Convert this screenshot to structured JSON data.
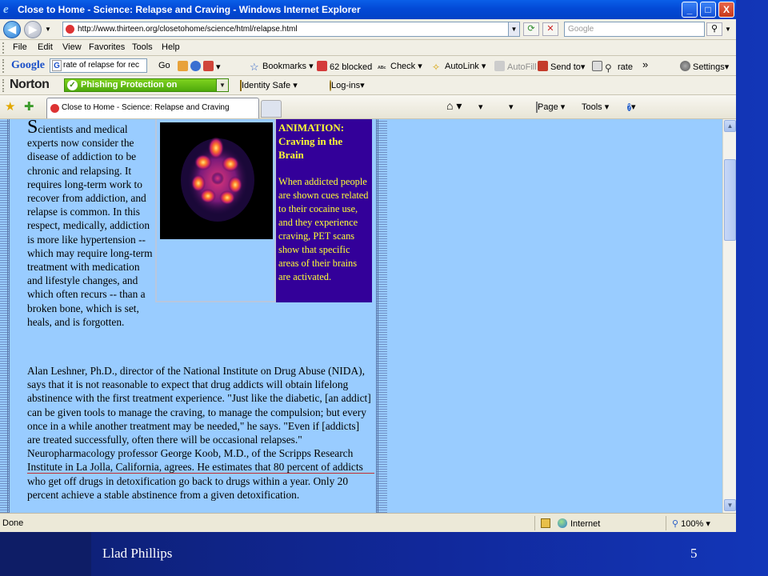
{
  "window": {
    "title": "Close to Home - Science: Relapse and Craving - Windows Internet Explorer",
    "controls": {
      "minimize": "_",
      "maximize": "□",
      "close": "X"
    }
  },
  "address_bar": {
    "url": "http://www.thirteen.org/closetohome/science/html/relapse.html",
    "search_placeholder": "Google"
  },
  "menu": [
    "File",
    "Edit",
    "View",
    "Favorites",
    "Tools",
    "Help"
  ],
  "google_toolbar": {
    "logo": "Google",
    "search_value": "rate of relapse for rec",
    "go_label": "Go",
    "bookmarks": "Bookmarks",
    "blocked": "62 blocked",
    "check": "Check",
    "autolink": "AutoLink",
    "autofill": "AutoFill",
    "send_to": "Send to",
    "rate": "rate",
    "more": "»",
    "settings": "Settings"
  },
  "norton_toolbar": {
    "logo": "Norton",
    "phishing": "Phishing Protection on",
    "identity": "Identity Safe",
    "logins": "Log-ins"
  },
  "tab": {
    "label": "Close to Home - Science: Relapse and Craving"
  },
  "command_bar": {
    "page": "Page",
    "tools": "Tools",
    "help": "?"
  },
  "article": {
    "drop_cap": "S",
    "intro": "cientists and medical experts now consider the disease of addiction to be chronic and relapsing. It requires long-term work to recover from addiction, and relapse is common. In this respect, medically, addiction is more like hypertension -- which may require long-term treatment with medication and lifestyle changes, and which often recurs -- than a broken bone, which is set, heals, and is forgotten.",
    "paragraph": "Alan Leshner, Ph.D., director of the National Institute on Drug Abuse (NIDA), says that it is not reasonable to expect that drug addicts will obtain lifelong abstinence with the first treatment experience. \"Just like the diabetic, [an addict] can be given tools to manage the craving, to manage the compulsion; but every once in a while another treatment may be needed,\" he says. \"Even if [addicts] are treated successfully, often there will be occasional relapses.\" Neuropharmacology professor George Koob, M.D., of the Scripps Research Institute in La Jolla, California, agrees. He estimates that 80 percent of addicts who get off drugs in detoxification go back to drugs within a year. Only 20 percent achieve a stable abstinence from a given detoxification.",
    "animation_heading": "ANIMATION: Craving in the Brain",
    "animation_body": "When addicted people are shown cues related to their cocaine use, and they experience craving, PET scans show that specific areas of their brains are activated."
  },
  "status_bar": {
    "status": "Done",
    "zone": "Internet",
    "zoom": "100%"
  },
  "footer": {
    "author": "Llad Phillips",
    "slide_number": "5"
  }
}
